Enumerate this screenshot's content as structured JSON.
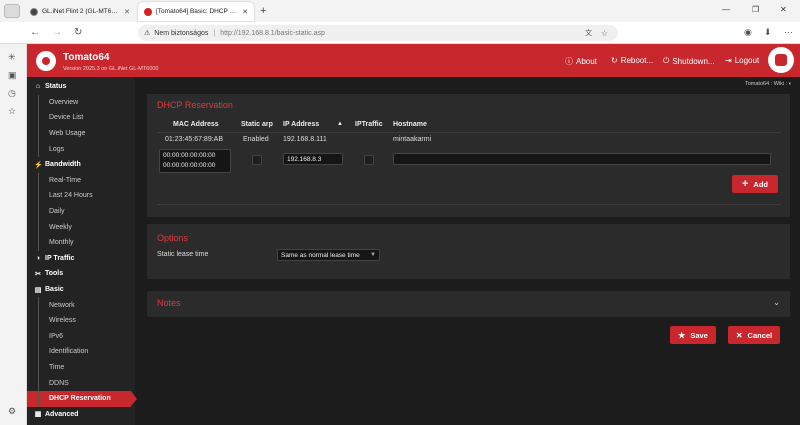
{
  "browser": {
    "tabs": [
      {
        "title": "GL.iNet Flint 2 (GL-MT6000) rou"
      },
      {
        "title": "[Tomato64] Basic: DHCP Reserva"
      }
    ],
    "new_tab": "+",
    "security_label": "Nem biztonságos",
    "url": "http://192.168.8.1/basic-static.asp"
  },
  "header": {
    "brand": "Tomato64",
    "version": "Version 2025.3 on GL.iNet GL-MT6000",
    "links": [
      "About",
      "Reboot...",
      "Shutdown...",
      "Logout"
    ]
  },
  "breadcrumb": "Tomato64 : Wiki : ◐",
  "sidebar": {
    "items": [
      {
        "label": "Status",
        "type": "head",
        "icon": "home-icon"
      },
      {
        "label": "Overview",
        "type": "sub"
      },
      {
        "label": "Device List",
        "type": "sub"
      },
      {
        "label": "Web Usage",
        "type": "sub"
      },
      {
        "label": "Logs",
        "type": "sub"
      },
      {
        "label": "Bandwidth",
        "type": "head",
        "icon": "bandwidth-icon"
      },
      {
        "label": "Real-Time",
        "type": "sub"
      },
      {
        "label": "Last 24 Hours",
        "type": "sub"
      },
      {
        "label": "Daily",
        "type": "sub"
      },
      {
        "label": "Weekly",
        "type": "sub"
      },
      {
        "label": "Monthly",
        "type": "sub"
      },
      {
        "label": "IP Traffic",
        "type": "head",
        "icon": "ip-traffic-icon"
      },
      {
        "label": "Tools",
        "type": "head",
        "icon": "tools-icon"
      },
      {
        "label": "Basic",
        "type": "head",
        "icon": "basic-icon"
      },
      {
        "label": "Network",
        "type": "sub"
      },
      {
        "label": "Wireless",
        "type": "sub"
      },
      {
        "label": "IPv6",
        "type": "sub"
      },
      {
        "label": "Identification",
        "type": "sub"
      },
      {
        "label": "Time",
        "type": "sub"
      },
      {
        "label": "DDNS",
        "type": "sub"
      },
      {
        "label": "DHCP Reservation",
        "type": "sub",
        "active": true
      },
      {
        "label": "Advanced",
        "type": "head",
        "icon": "advanced-icon"
      }
    ]
  },
  "reservation": {
    "title": "DHCP Reservation",
    "columns": [
      "MAC Address",
      "Static arp",
      "IP Address",
      "IPTraffic",
      "Hostname"
    ],
    "sort_indicator": "▲",
    "rows": [
      {
        "mac": "01:23:45:67:89:AB",
        "static_arp": "Enabled",
        "ip": "192.168.8.111",
        "iptraffic": "",
        "hostname": "mintaakarmi"
      }
    ],
    "edit": {
      "mac1": "00:00:00:00:00:00",
      "mac2": "00:00:00:00:00:00",
      "ip": "192.168.8.3",
      "hostname": ""
    },
    "add_label": "Add"
  },
  "options": {
    "title": "Options",
    "static_lease_label": "Static lease time",
    "static_lease_value": "Same as normal lease time"
  },
  "notes": {
    "title": "Notes"
  },
  "actions": {
    "save_label": "Save",
    "cancel_label": "Cancel"
  },
  "colors": {
    "accent": "#c8272d",
    "background": "#1c1c1c",
    "panel": "#2b2b2b",
    "title": "#e0393e"
  }
}
